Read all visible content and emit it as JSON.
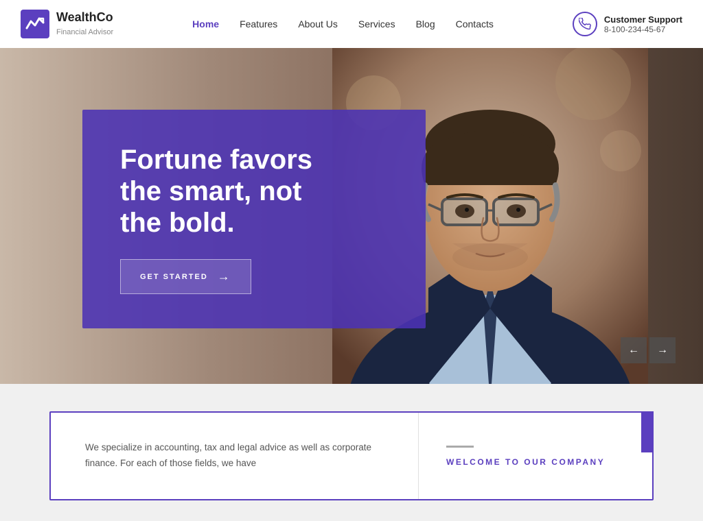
{
  "header": {
    "logo_name": "WealthCo",
    "logo_subtitle": "Financial Advisor",
    "nav": {
      "items": [
        {
          "label": "Home",
          "active": true
        },
        {
          "label": "Features",
          "active": false
        },
        {
          "label": "About Us",
          "active": false
        },
        {
          "label": "Services",
          "active": false
        },
        {
          "label": "Blog",
          "active": false
        },
        {
          "label": "Contacts",
          "active": false
        }
      ]
    },
    "support": {
      "label": "Customer Support",
      "phone": "8-100-234-45-67"
    }
  },
  "hero": {
    "headline": "Fortune favors\nthe smart, not\nthe bold.",
    "cta_label": "GET STARTED",
    "slide_prev": "←",
    "slide_next": "→"
  },
  "below_hero": {
    "body_text": "We specialize in accounting, tax and legal advice as well\nas corporate finance. For each of those fields, we have",
    "welcome_label": "WELCOME TO OUR COMPANY"
  }
}
